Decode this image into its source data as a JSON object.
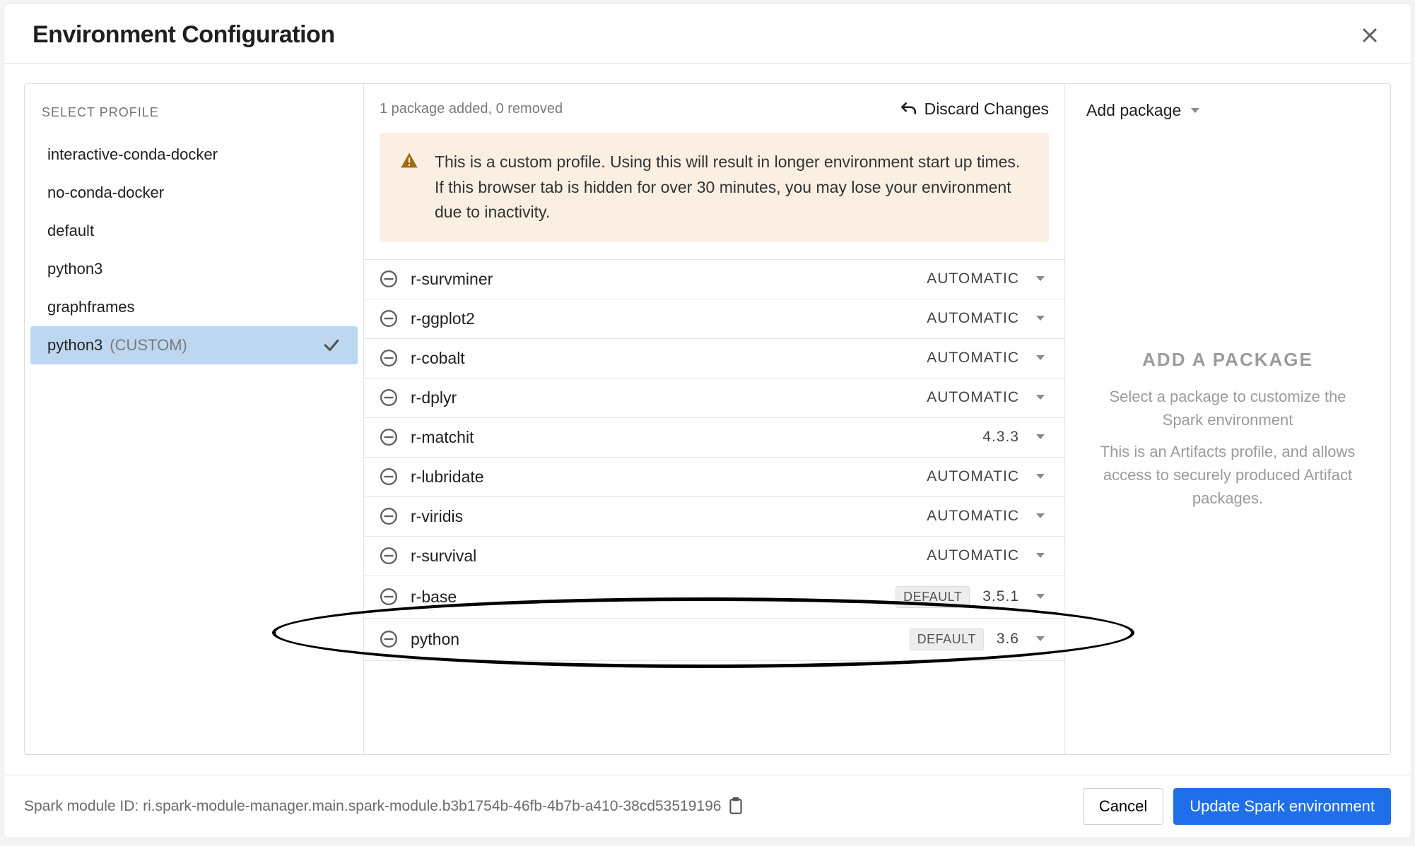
{
  "header": {
    "title": "Environment Configuration"
  },
  "sidebar": {
    "title": "SELECT PROFILE",
    "profiles": [
      {
        "name": "interactive-conda-docker",
        "selected": false,
        "custom": false
      },
      {
        "name": "no-conda-docker",
        "selected": false,
        "custom": false
      },
      {
        "name": "default",
        "selected": false,
        "custom": false
      },
      {
        "name": "python3",
        "selected": false,
        "custom": false
      },
      {
        "name": "graphframes",
        "selected": false,
        "custom": false
      },
      {
        "name": "python3",
        "selected": true,
        "custom": true,
        "custom_label": "(CUSTOM)"
      }
    ]
  },
  "center": {
    "change_summary": "1 package added, 0 removed",
    "discard_label": "Discard Changes",
    "warning": "This is a custom profile. Using this will result in longer environment start up times. If this browser tab is hidden for over 30 minutes, you may lose your environment due to inactivity.",
    "packages": [
      {
        "name": "r-survminer",
        "version": "AUTOMATIC",
        "badge": ""
      },
      {
        "name": "r-ggplot2",
        "version": "AUTOMATIC",
        "badge": ""
      },
      {
        "name": "r-cobalt",
        "version": "AUTOMATIC",
        "badge": ""
      },
      {
        "name": "r-dplyr",
        "version": "AUTOMATIC",
        "badge": ""
      },
      {
        "name": "r-matchit",
        "version": "4.3.3",
        "badge": ""
      },
      {
        "name": "r-lubridate",
        "version": "AUTOMATIC",
        "badge": ""
      },
      {
        "name": "r-viridis",
        "version": "AUTOMATIC",
        "badge": ""
      },
      {
        "name": "r-survival",
        "version": "AUTOMATIC",
        "badge": ""
      },
      {
        "name": "r-base",
        "version": "3.5.1",
        "badge": "DEFAULT"
      },
      {
        "name": "python",
        "version": "3.6",
        "badge": "DEFAULT"
      }
    ]
  },
  "right": {
    "add_package_label": "Add package",
    "empty_title": "ADD A PACKAGE",
    "empty_line1": "Select a package to customize the Spark environment",
    "empty_line2": "This is an Artifacts profile, and allows access to securely produced Artifact packages."
  },
  "footer": {
    "module_id": "Spark module ID: ri.spark-module-manager.main.spark-module.b3b1754b-46fb-4b7b-a410-38cd53519196",
    "cancel_label": "Cancel",
    "update_label": "Update Spark environment"
  }
}
